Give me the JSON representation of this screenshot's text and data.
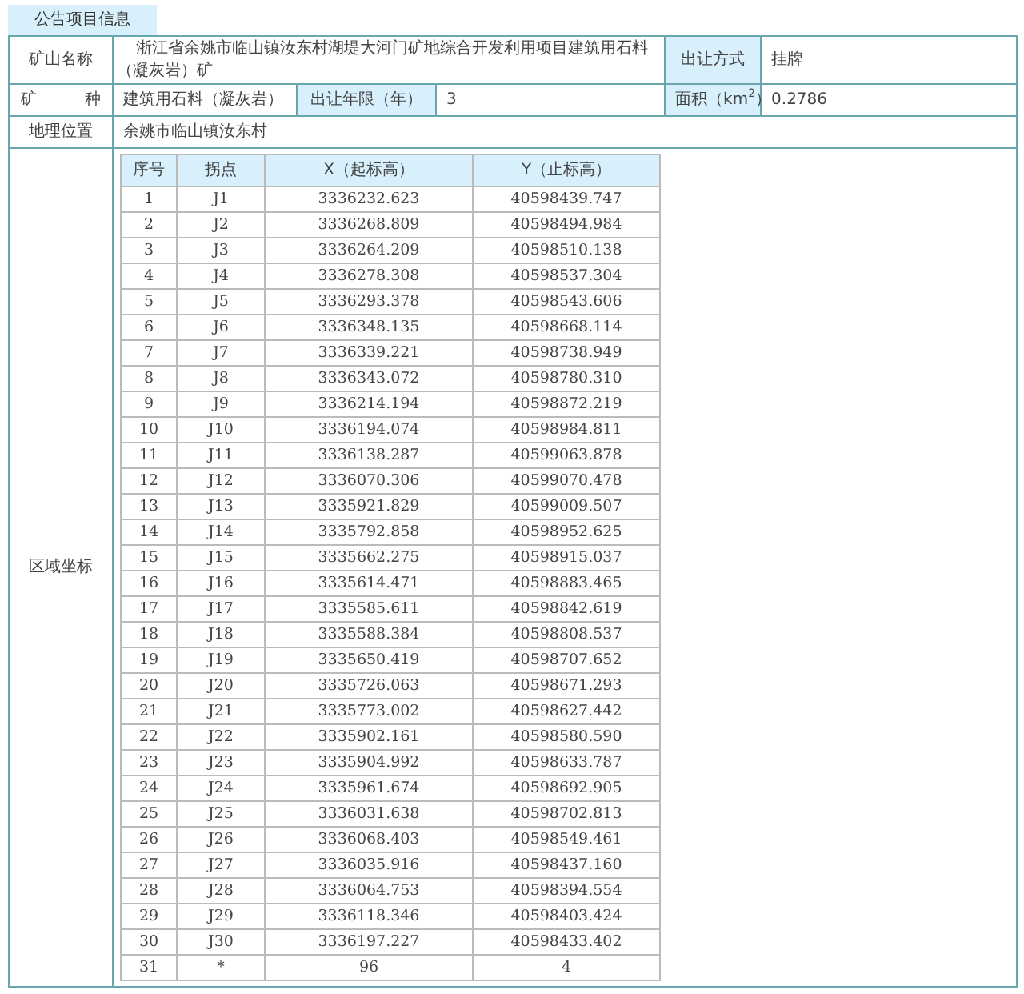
{
  "section_tab": "公告项目信息",
  "mine_name": {
    "label": "矿山名称",
    "value": "浙江省余姚市临山镇汝东村湖堤大河门矿地综合开发利用项目建筑用石料（凝灰岩）矿"
  },
  "transfer_method": {
    "label": "出让方式",
    "value": "挂牌"
  },
  "mineral": {
    "label": "矿　　　种",
    "value": "建筑用石料（凝灰岩）"
  },
  "term": {
    "label": "出让年限（年）",
    "value": "3"
  },
  "area": {
    "label": "面积（km$^{2}$）",
    "value": "0.2786"
  },
  "location": {
    "label": "地理位置",
    "value": "余姚市临山镇汝东村"
  },
  "coordinates": {
    "label": "区域坐标",
    "columns": [
      "序号",
      "拐点",
      "X（起标高）",
      "Y（止标高）"
    ],
    "rows": [
      [
        "1",
        "J1",
        "3336232.623",
        "40598439.747"
      ],
      [
        "2",
        "J2",
        "3336268.809",
        "40598494.984"
      ],
      [
        "3",
        "J3",
        "3336264.209",
        "40598510.138"
      ],
      [
        "4",
        "J4",
        "3336278.308",
        "40598537.304"
      ],
      [
        "5",
        "J5",
        "3336293.378",
        "40598543.606"
      ],
      [
        "6",
        "J6",
        "3336348.135",
        "40598668.114"
      ],
      [
        "7",
        "J7",
        "3336339.221",
        "40598738.949"
      ],
      [
        "8",
        "J8",
        "3336343.072",
        "40598780.310"
      ],
      [
        "9",
        "J9",
        "3336214.194",
        "40598872.219"
      ],
      [
        "10",
        "J10",
        "3336194.074",
        "40598984.811"
      ],
      [
        "11",
        "J11",
        "3336138.287",
        "40599063.878"
      ],
      [
        "12",
        "J12",
        "3336070.306",
        "40599070.478"
      ],
      [
        "13",
        "J13",
        "3335921.829",
        "40599009.507"
      ],
      [
        "14",
        "J14",
        "3335792.858",
        "40598952.625"
      ],
      [
        "15",
        "J15",
        "3335662.275",
        "40598915.037"
      ],
      [
        "16",
        "J16",
        "3335614.471",
        "40598883.465"
      ],
      [
        "17",
        "J17",
        "3335585.611",
        "40598842.619"
      ],
      [
        "18",
        "J18",
        "3335588.384",
        "40598808.537"
      ],
      [
        "19",
        "J19",
        "3335650.419",
        "40598707.652"
      ],
      [
        "20",
        "J20",
        "3335726.063",
        "40598671.293"
      ],
      [
        "21",
        "J21",
        "3335773.002",
        "40598627.442"
      ],
      [
        "22",
        "J22",
        "3335902.161",
        "40598580.590"
      ],
      [
        "23",
        "J23",
        "3335904.992",
        "40598633.787"
      ],
      [
        "24",
        "J24",
        "3335961.674",
        "40598692.905"
      ],
      [
        "25",
        "J25",
        "3336031.638",
        "40598702.813"
      ],
      [
        "26",
        "J26",
        "3336068.403",
        "40598549.461"
      ],
      [
        "27",
        "J27",
        "3336035.916",
        "40598437.160"
      ],
      [
        "28",
        "J28",
        "3336064.753",
        "40598394.554"
      ],
      [
        "29",
        "J29",
        "3336118.346",
        "40598403.424"
      ],
      [
        "30",
        "J30",
        "3336197.227",
        "40598433.402"
      ],
      [
        "31",
        "*",
        "96",
        "4"
      ]
    ]
  }
}
